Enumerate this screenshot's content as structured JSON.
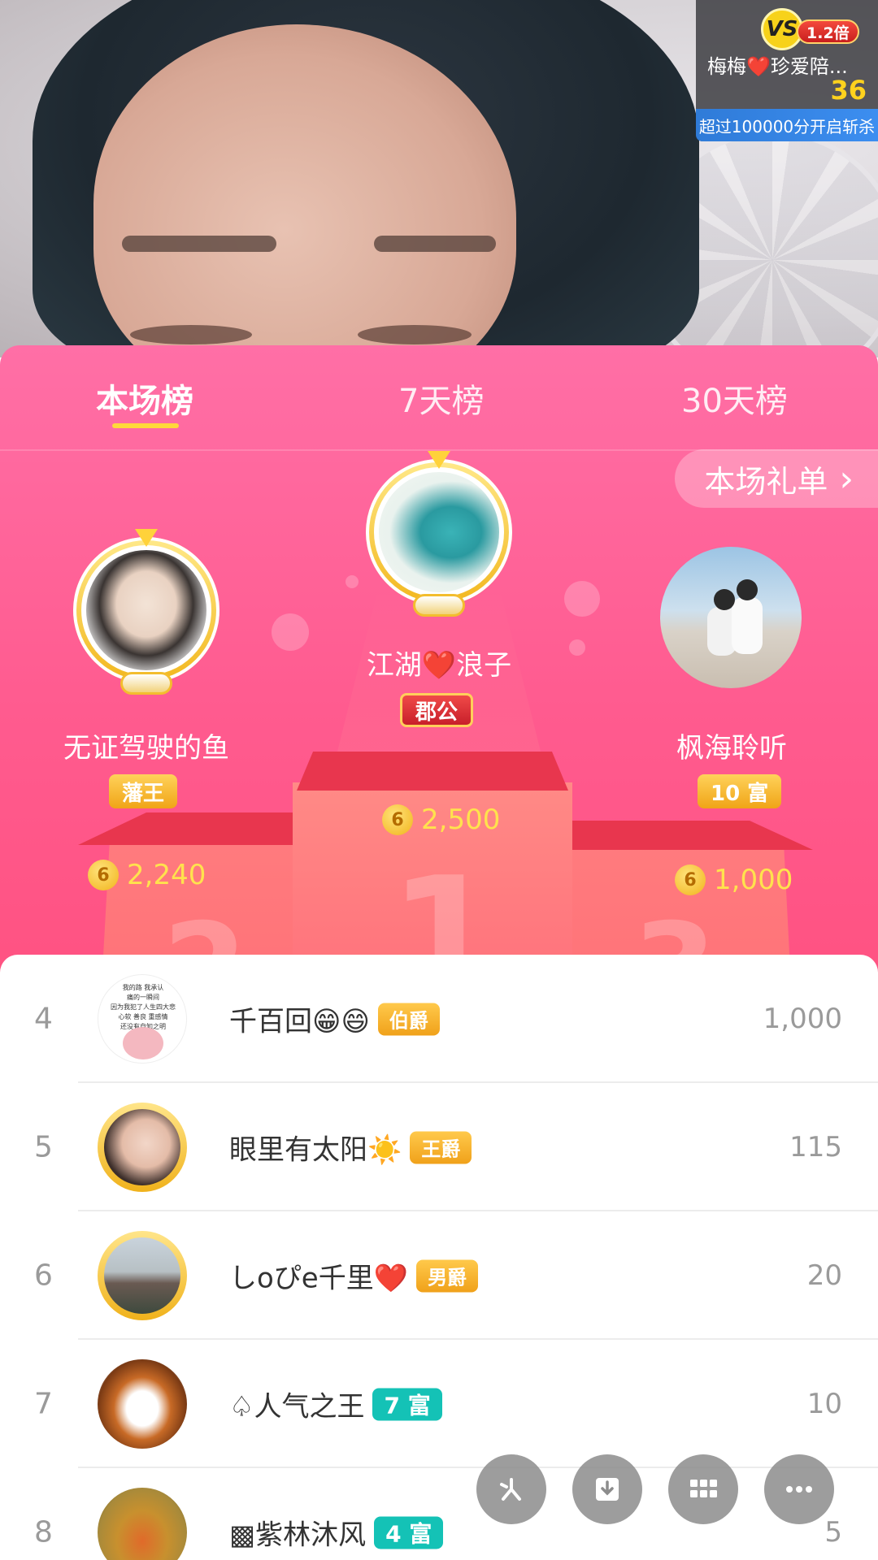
{
  "pk": {
    "vs_label": "VS",
    "multiplier": "1.2倍",
    "name": "梅梅❤️珍爱陪...",
    "score": "36",
    "note": "超过100000分开启斩杀"
  },
  "tabs": [
    {
      "label": "本场榜"
    },
    {
      "label": "7天榜"
    },
    {
      "label": "30天榜"
    }
  ],
  "gift_list_label": "本场礼单",
  "gift_list_chevron": "›",
  "podium": {
    "first": {
      "name": "江湖❤️浪子",
      "badge": "郡公",
      "score": "2,500",
      "rank": "1"
    },
    "second": {
      "name": "无证驾驶的鱼",
      "badge": "藩王",
      "score": "2,240",
      "rank": "2"
    },
    "third": {
      "name": "枫海聆听",
      "badge": "10 富",
      "score": "1,000",
      "rank": "3"
    }
  },
  "coin_symbol": "6",
  "rows": [
    {
      "rank": "4",
      "name": "千百回😁😄",
      "tag": "伯爵",
      "value": "1,000"
    },
    {
      "rank": "5",
      "name": "眼里有太阳☀️",
      "tag": "王爵",
      "value": "115"
    },
    {
      "rank": "6",
      "name": "しoぴe千里❤️",
      "tag": "男爵",
      "value": "20"
    },
    {
      "rank": "7",
      "name": "♤人气之王",
      "tag": "7 富",
      "value": "10"
    },
    {
      "rank": "8",
      "name": "▩紫林沐风",
      "tag": "4 富",
      "value": "5"
    }
  ],
  "avatar_text_row4": [
    "我的路 我承认",
    "痛的一瞬间",
    "因为我犯了人生四大悲",
    "心软 善良 重感情",
    "还没有自知之明"
  ],
  "colors": {
    "panel_pink": "#ff5b8f",
    "tab_indicator": "#ffd83a",
    "score_gold": "#ffe24d",
    "wealth_teal": "#14c2b6"
  },
  "fab_icons": [
    "sparkle-icon",
    "download-icon",
    "grid-icon",
    "more-icon"
  ]
}
